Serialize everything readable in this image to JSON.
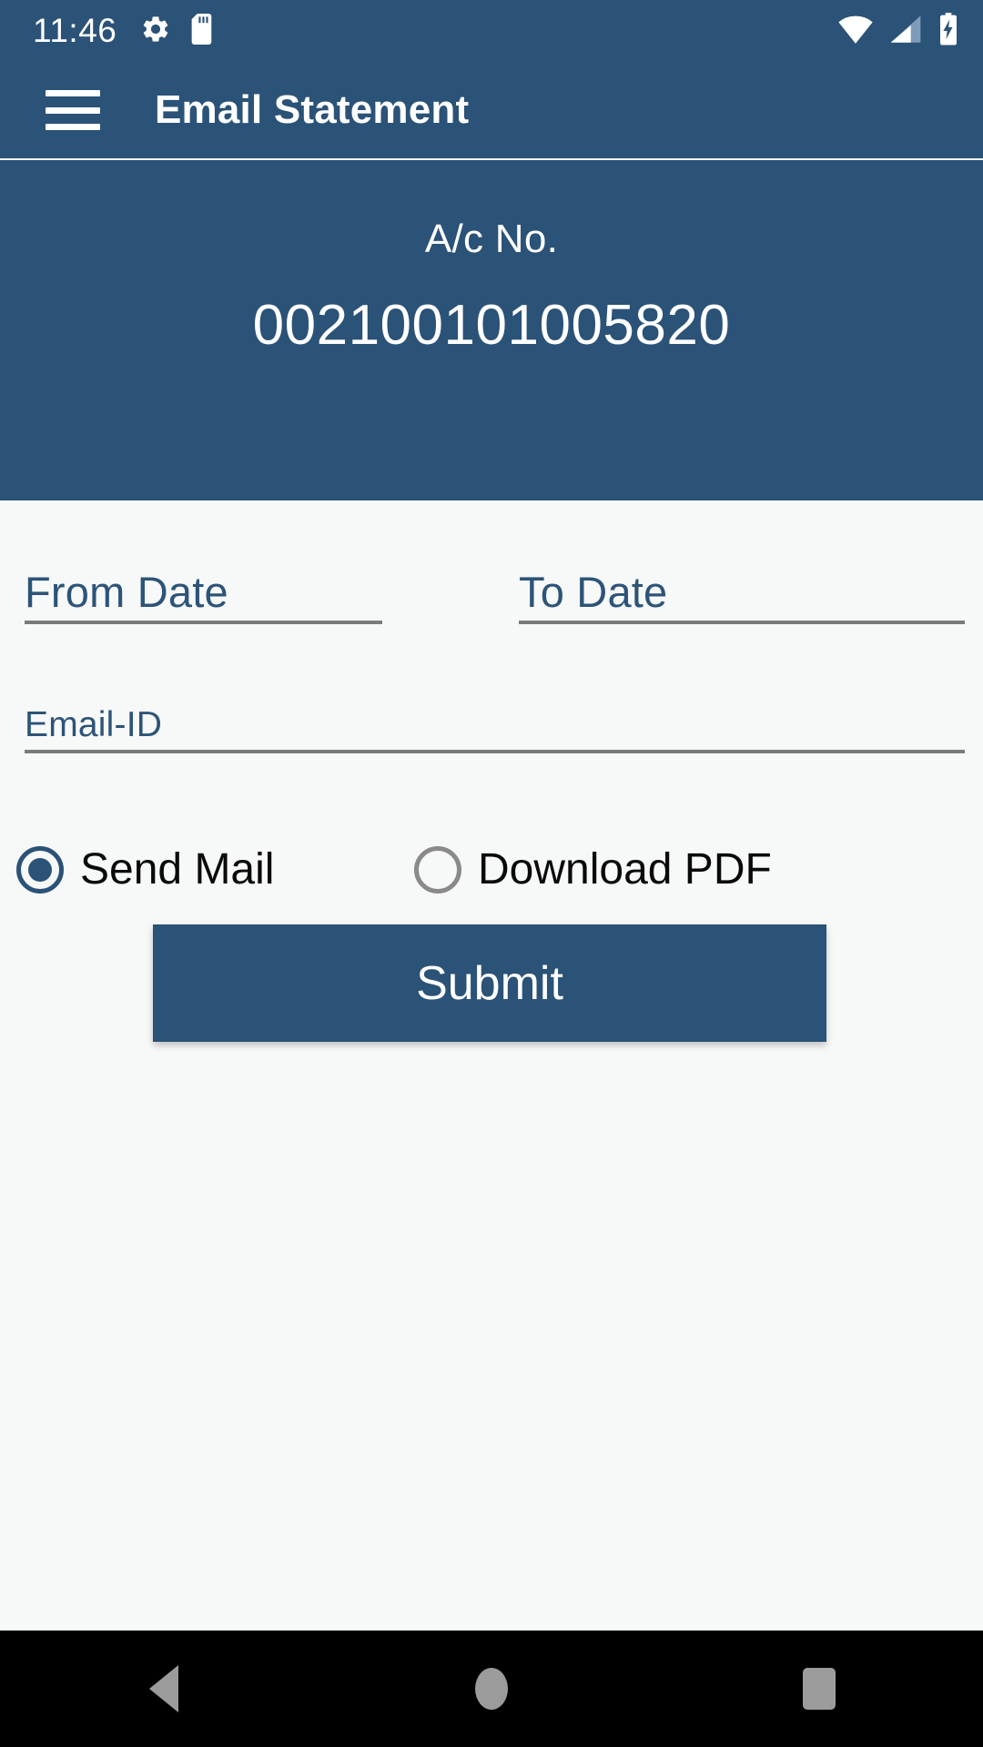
{
  "statusbar": {
    "time": "11:46",
    "icons": [
      "gear-icon",
      "sd-card-icon"
    ],
    "right_icons": [
      "wifi-icon",
      "cell-signal-icon",
      "battery-charging-icon"
    ]
  },
  "appbar": {
    "menu_icon": "hamburger-menu-icon",
    "title": "Email Statement"
  },
  "account_header": {
    "label": "A/c No.",
    "number": "002100101005820"
  },
  "form": {
    "from_date": {
      "placeholder": "From Date",
      "value": ""
    },
    "to_date": {
      "placeholder": "To Date",
      "value": ""
    },
    "email_id": {
      "placeholder": "Email-ID",
      "value": ""
    },
    "delivery_options": [
      {
        "label": "Send Mail",
        "selected": true
      },
      {
        "label": "Download PDF",
        "selected": false
      }
    ],
    "submit_label": "Submit"
  },
  "navbar": {
    "back": "back-nav-button",
    "home": "home-nav-button",
    "recents": "recents-nav-button"
  },
  "colors": {
    "primary": "#2b5277",
    "background": "#f7f8f8",
    "field_label": "#2d5478",
    "field_underline": "#7b7b7b",
    "navbar_bg": "#000000",
    "navbar_icon": "#9b9b9b"
  }
}
